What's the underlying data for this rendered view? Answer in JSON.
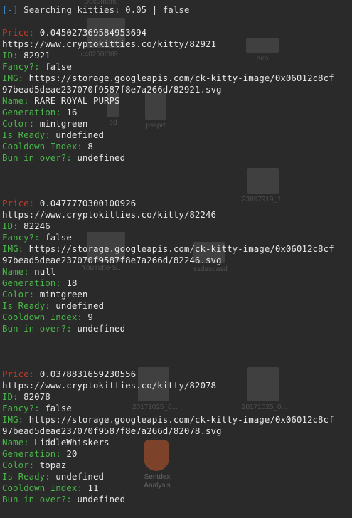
{
  "status_line": {
    "indicator": "[-]",
    "text": "Searching kitties: 0.05 | false"
  },
  "labels": {
    "price": "Price:",
    "id": "ID:",
    "fancy": "Fancy?:",
    "img": "IMG:",
    "name": "Name:",
    "generation": "Generation:",
    "color": "Color:",
    "is_ready": "Is Ready:",
    "cooldown_index": "Cooldown Index:",
    "bun_in_oven": "Bun in over?:"
  },
  "kitties": [
    {
      "price": "0.045027369584953694",
      "url": "https://www.cryptokitties.co/kitty/82921",
      "id": "82921",
      "fancy": "false",
      "img_line1": "https://storage.googleapis.com/ck-kitty-image/0x06012c8cf",
      "img_line2": "97bead5deae237070f9587f8e7a266d/82921.svg",
      "name": "RARE ROYAL PURPS",
      "generation": "16",
      "color": "mintgreen",
      "is_ready": "undefined",
      "cooldown_index": "8",
      "bun_in_oven": "undefined"
    },
    {
      "price": "0.0477770300100926",
      "url": "https://www.cryptokitties.co/kitty/82246",
      "id": "82246",
      "fancy": "false",
      "img_line1": "https://storage.googleapis.com/ck-kitty-image/0x06012c8cf",
      "img_line2": "97bead5deae237070f9587f8e7a266d/82246.svg",
      "name": "null",
      "generation": "18",
      "color": "mintgreen",
      "is_ready": "undefined",
      "cooldown_index": "9",
      "bun_in_oven": "undefined"
    },
    {
      "price": "0.0378831659230556",
      "url": "https://www.cryptokitties.co/kitty/82078",
      "id": "82078",
      "fancy": "false",
      "img_line1": "https://storage.googleapis.com/ck-kitty-image/0x06012c8cf",
      "img_line2": "97bead5deae237070f9587f8e7a266d/82078.svg",
      "name": "LiddleWhiskers",
      "generation": "20",
      "color": "topaz",
      "is_ready": "undefined",
      "cooldown_index": "11",
      "bun_in_oven": "undefined"
    }
  ],
  "desktop_icons": [
    {
      "label": "Document"
    },
    {
      "label": "c40250f069..."
    },
    {
      "label": "neo"
    },
    {
      "label": "ed"
    },
    {
      "label": "pssprt"
    },
    {
      "label": "23897919_1..."
    },
    {
      "label": "YouTube-S..."
    },
    {
      "label": "ssdasdasd"
    },
    {
      "label": "20171025_0..."
    },
    {
      "label": "20171025_0..."
    },
    {
      "label": "Sentdex Analysis"
    }
  ]
}
